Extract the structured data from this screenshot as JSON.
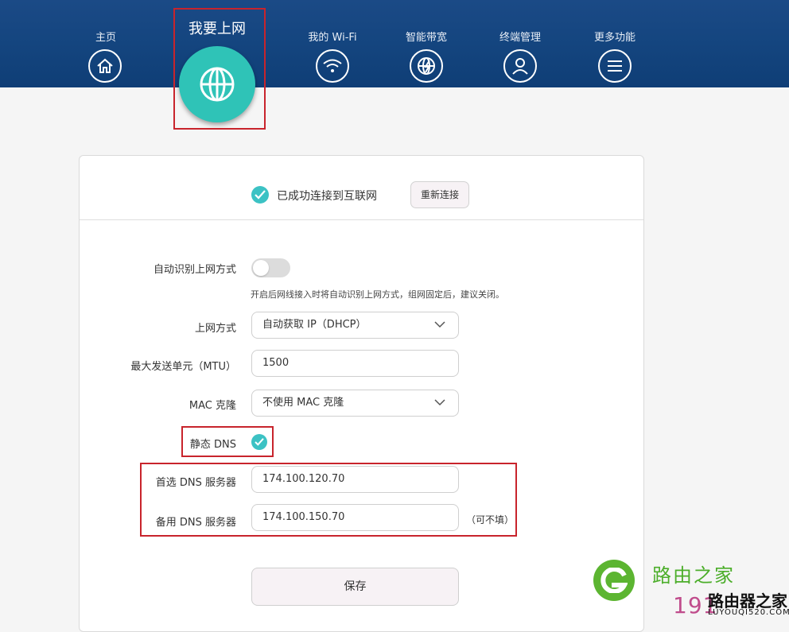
{
  "nav": {
    "items": [
      {
        "label": "主页",
        "icon": "home-icon"
      },
      {
        "label": "我要上网",
        "icon": "globe-icon",
        "active": true
      },
      {
        "label": "我的 Wi-Fi",
        "icon": "wifi-icon"
      },
      {
        "label": "智能带宽",
        "icon": "bandwidth-icon"
      },
      {
        "label": "终端管理",
        "icon": "user-icon"
      },
      {
        "label": "更多功能",
        "icon": "menu-icon"
      }
    ]
  },
  "status": {
    "text": "已成功连接到互联网",
    "reconnect_label": "重新连接"
  },
  "form": {
    "auto_detect_label": "自动识别上网方式",
    "auto_detect_enabled": false,
    "auto_detect_hint": "开启后网线接入时将自动识别上网方式，组网固定后，建议关闭。",
    "mode_label": "上网方式",
    "mode_value": "自动获取 IP（DHCP）",
    "mtu_label": "最大发送单元（MTU）",
    "mtu_value": "1500",
    "mac_label": "MAC 克隆",
    "mac_value": "不使用 MAC 克隆",
    "static_dns_label": "静态 DNS",
    "static_dns_checked": true,
    "dns1_label": "首选 DNS 服务器",
    "dns1_value": "174.100.120.70",
    "dns2_label": "备用 DNS 服务器",
    "dns2_value": "174.100.150.70",
    "optional_note": "（可不填）",
    "save_label": "保存"
  },
  "watermark": {
    "name": "路由之家",
    "number": "191",
    "brand": "路由器之家",
    "domain": "LUYOUQI520.COM"
  },
  "colors": {
    "header_blue": "#14457f",
    "accent_teal": "#2fc3b7",
    "highlight_red": "#c8242c"
  }
}
